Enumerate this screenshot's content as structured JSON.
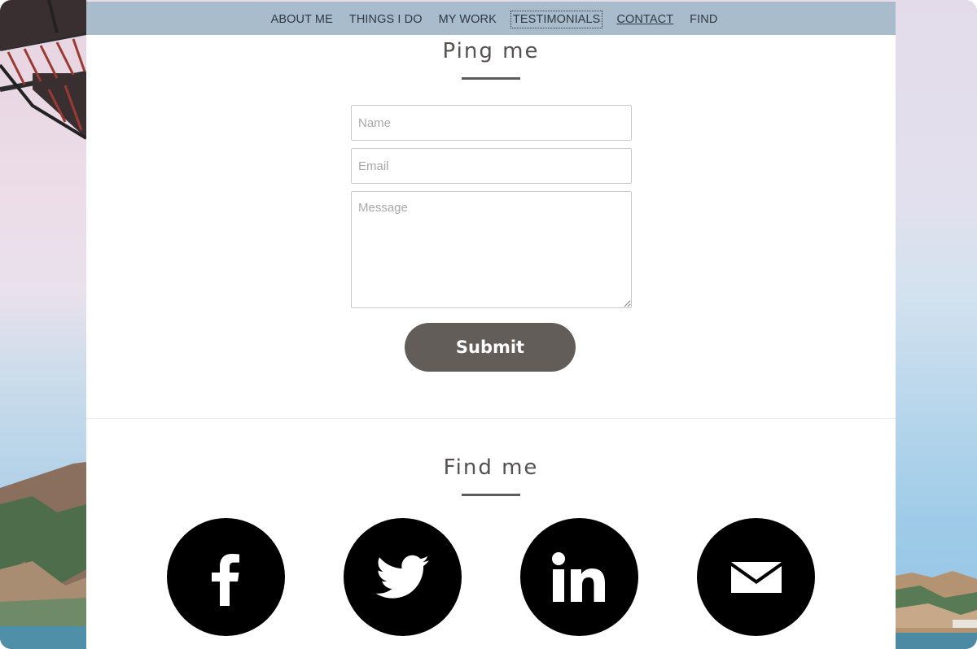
{
  "nav": {
    "items": [
      {
        "label": "ABOUT ME"
      },
      {
        "label": "THINGS I DO"
      },
      {
        "label": "MY WORK"
      },
      {
        "label": "TESTIMONIALS"
      },
      {
        "label": "CONTACT"
      },
      {
        "label": "FIND"
      }
    ],
    "focused": "TESTIMONIALS",
    "active": "CONTACT"
  },
  "contact": {
    "title": "Ping me",
    "name_placeholder": "Name",
    "email_placeholder": "Email",
    "message_placeholder": "Message",
    "submit_label": "Submit"
  },
  "find": {
    "title": "Find me",
    "social": [
      {
        "icon": "facebook-icon"
      },
      {
        "icon": "twitter-icon"
      },
      {
        "icon": "linkedin-icon"
      },
      {
        "icon": "email-icon"
      }
    ]
  },
  "colors": {
    "navbar": "#a8bccb",
    "button": "#625d59",
    "social_circle": "#000000"
  }
}
